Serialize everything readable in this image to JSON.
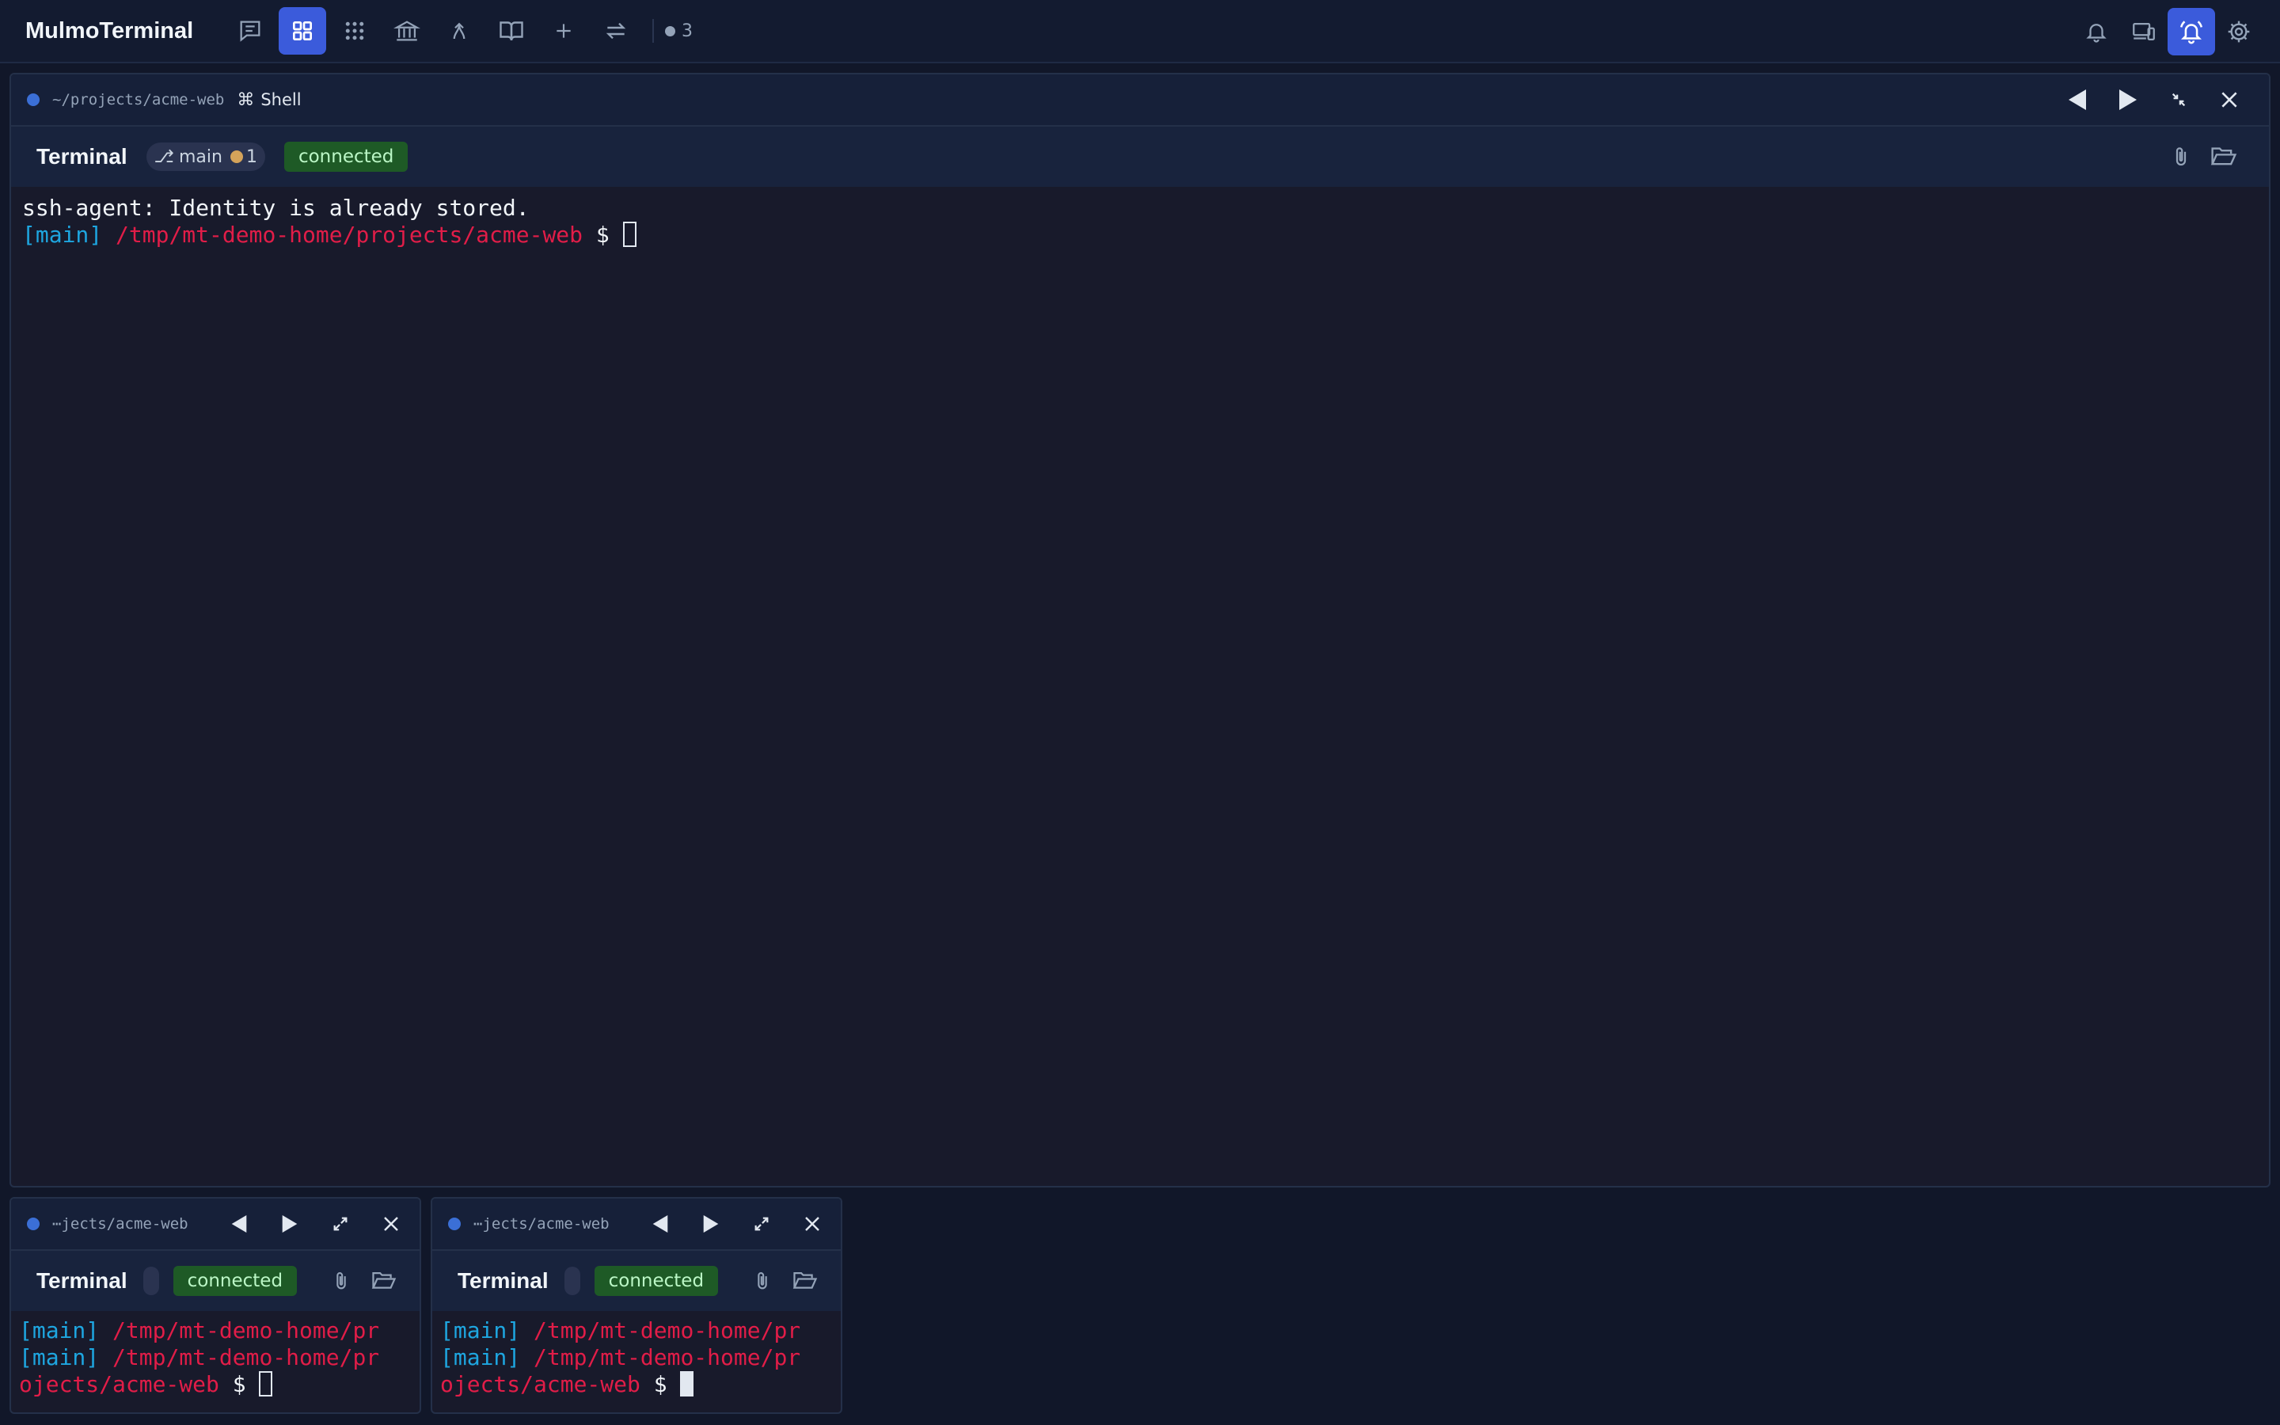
{
  "app": {
    "title": "MulmoTerminal"
  },
  "nav": {
    "icons": [
      "chat-icon",
      "grid-icon",
      "apps-icon",
      "bank-icon",
      "merge-icon",
      "book-icon",
      "plus-icon",
      "swap-icon"
    ],
    "active": "grid-icon",
    "session_count": "3"
  },
  "topbar_right": {
    "icons": [
      "bell-icon",
      "devices-icon",
      "bell-ringing-icon",
      "gear-icon"
    ],
    "active": "bell-ringing-icon"
  },
  "main_panel": {
    "path": "~/projects/acme-web",
    "shell_glyph": "⌘",
    "shell_label": "Shell",
    "title": "Terminal",
    "branch_glyph": "⎇",
    "branch": "main",
    "branch_count": "1",
    "status": "connected",
    "lines": [
      {
        "text": "ssh-agent: Identity is already stored."
      }
    ],
    "prompt": {
      "branch": "[main]",
      "path": "/tmp/mt-demo-home/projects/acme-web",
      "symbol": "$"
    }
  },
  "mini_panels": [
    {
      "path": "⋯jects/acme-web",
      "title": "Terminal",
      "status": "connected",
      "line1_branch": "[main]",
      "line1_path": "/tmp/mt-demo-home/pr",
      "line2_branch": "[main]",
      "line2_path": "/tmp/mt-demo-home/pr",
      "line3_path": "ojects/acme-web",
      "symbol": "$"
    },
    {
      "path": "⋯jects/acme-web",
      "title": "Terminal",
      "status": "connected",
      "line1_branch": "[main]",
      "line1_path": "/tmp/mt-demo-home/pr",
      "line2_branch": "[main]",
      "line2_path": "/tmp/mt-demo-home/pr",
      "line3_path": "ojects/acme-web",
      "symbol": "$"
    }
  ],
  "colors": {
    "accent": "#3b5bdb",
    "connected_bg": "#1e5a26",
    "prompt_branch": "#1ea6e0",
    "prompt_path": "#e11d48"
  }
}
